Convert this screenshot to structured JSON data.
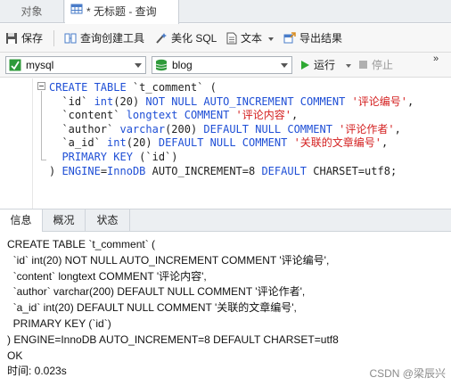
{
  "tabs": {
    "objects": "对象",
    "query": "* 无标题 - 查询"
  },
  "toolbar": {
    "save": "保存",
    "query_builder": "查询创建工具",
    "beautify_sql": "美化 SQL",
    "text": "文本",
    "export_results": "导出结果"
  },
  "connection": {
    "server": "mysql",
    "database": "blog",
    "run": "运行",
    "stop": "停止",
    "more": "»"
  },
  "editor": {
    "lines": [
      [
        [
          "kw",
          "CREATE TABLE "
        ],
        [
          "plain",
          "`t_comment`"
        ],
        [
          "plain",
          " ("
        ]
      ],
      [
        [
          "plain",
          "  `id` "
        ],
        [
          "kw",
          "int"
        ],
        [
          "plain",
          "(20) "
        ],
        [
          "kw",
          "NOT NULL AUTO_INCREMENT COMMENT "
        ],
        [
          "str",
          "'评论编号'"
        ],
        [
          "plain",
          ","
        ]
      ],
      [
        [
          "plain",
          "  `content` "
        ],
        [
          "kw",
          "longtext COMMENT "
        ],
        [
          "str",
          "'评论内容'"
        ],
        [
          "plain",
          ","
        ]
      ],
      [
        [
          "plain",
          "  `author` "
        ],
        [
          "kw",
          "varchar"
        ],
        [
          "plain",
          "(200) "
        ],
        [
          "kw",
          "DEFAULT NULL COMMENT "
        ],
        [
          "str",
          "'评论作者'"
        ],
        [
          "plain",
          ","
        ]
      ],
      [
        [
          "plain",
          "  `a_id` "
        ],
        [
          "kw",
          "int"
        ],
        [
          "plain",
          "(20) "
        ],
        [
          "kw",
          "DEFAULT NULL COMMENT "
        ],
        [
          "str",
          "'关联的文章编号'"
        ],
        [
          "plain",
          ","
        ]
      ],
      [
        [
          "plain",
          "  "
        ],
        [
          "kw",
          "PRIMARY KEY "
        ],
        [
          "plain",
          "(`id`)"
        ]
      ],
      [
        [
          "plain",
          ") "
        ],
        [
          "kw",
          "ENGINE"
        ],
        [
          "plain",
          "="
        ],
        [
          "kw",
          "InnoDB "
        ],
        [
          "plain",
          "AUTO_INCREMENT=8 "
        ],
        [
          "kw",
          "DEFAULT "
        ],
        [
          "plain",
          "CHARSET=utf8;"
        ]
      ]
    ]
  },
  "result_tabs": {
    "info": "信息",
    "overview": "概况",
    "status": "状态"
  },
  "output": {
    "lines": [
      "CREATE TABLE `t_comment` (",
      "  `id` int(20) NOT NULL AUTO_INCREMENT COMMENT '评论编号',",
      "  `content` longtext COMMENT '评论内容',",
      "  `author` varchar(200) DEFAULT NULL COMMENT '评论作者',",
      "  `a_id` int(20) DEFAULT NULL COMMENT '关联的文章编号',",
      "  PRIMARY KEY (`id`)",
      ") ENGINE=InnoDB AUTO_INCREMENT=8 DEFAULT CHARSET=utf8",
      "OK",
      "时间: 0.023s"
    ]
  },
  "watermark": "CSDN @梁辰兴",
  "colors": {
    "keyword": "#1f4fd6",
    "string": "#d42020",
    "run_green": "#2ea832"
  }
}
